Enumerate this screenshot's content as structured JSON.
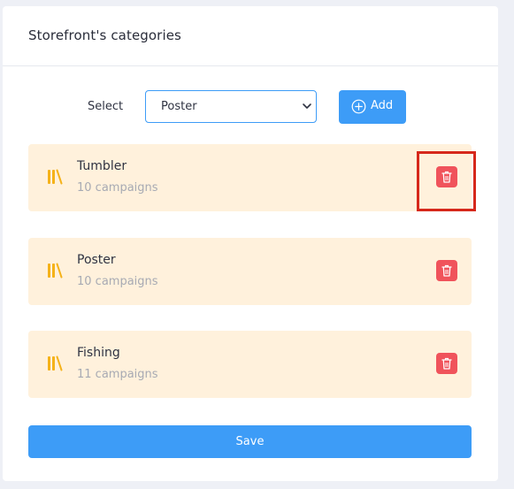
{
  "card": {
    "title": "Storefront's categories"
  },
  "form": {
    "select_label": "Select",
    "select_value": "Poster",
    "add_label": "Add"
  },
  "categories": [
    {
      "name": "Tumbler",
      "count": "10 campaigns"
    },
    {
      "name": "Poster",
      "count": "10 campaigns"
    },
    {
      "name": "Fishing",
      "count": "11 campaigns"
    }
  ],
  "save_label": "Save",
  "icons": {
    "category": "books-icon",
    "delete": "trash-icon",
    "add": "plus-circle-icon",
    "select": "chevron-down-icon"
  },
  "colors": {
    "accent": "#3d9cf7",
    "item_bg": "#fff1dc",
    "delete": "#f0535b",
    "category_icon": "#f5b21a",
    "highlight": "#d6281b"
  }
}
